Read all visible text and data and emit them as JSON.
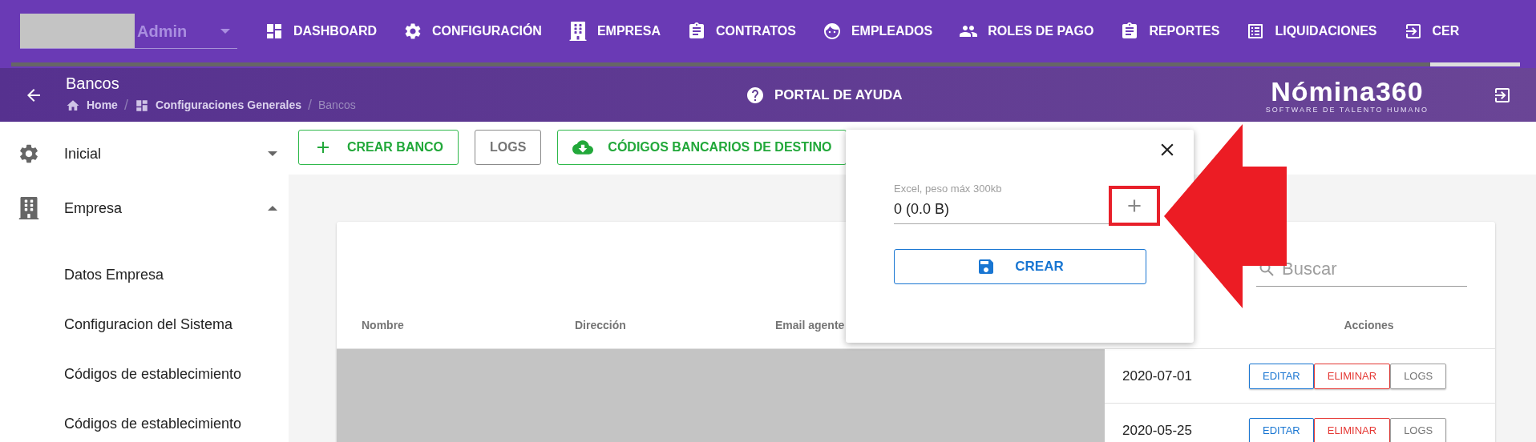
{
  "top_nav": {
    "user_select": {
      "value": "Admin"
    },
    "items": [
      {
        "label": "DASHBOARD"
      },
      {
        "label": "CONFIGURACIÓN"
      },
      {
        "label": "EMPRESA"
      },
      {
        "label": "CONTRATOS"
      },
      {
        "label": "EMPLEADOS"
      },
      {
        "label": "ROLES DE PAGO"
      },
      {
        "label": "REPORTES"
      },
      {
        "label": "LIQUIDACIONES"
      },
      {
        "label": "CER"
      }
    ]
  },
  "header": {
    "title": "Bancos",
    "breadcrumb": [
      {
        "label": "Home"
      },
      {
        "separator": "/",
        "label": "Configuraciones Generales"
      },
      {
        "separator": "/",
        "label": "Bancos"
      }
    ],
    "help_link": "PORTAL DE AYUDA",
    "logo": {
      "name": "Nómina360",
      "tagline": "SOFTWARE DE TALENTO HUMANO"
    }
  },
  "sidebar": {
    "items": [
      {
        "label": "Inicial",
        "expanded": false
      },
      {
        "label": "Empresa",
        "expanded": true,
        "children": [
          {
            "label": "Datos Empresa"
          },
          {
            "label": "Configuracion del Sistema"
          },
          {
            "label": "Códigos de establecimiento"
          },
          {
            "label": "Códigos de establecimiento"
          }
        ]
      }
    ]
  },
  "toolbar": [
    {
      "label": "CREAR BANCO",
      "kind": "add"
    },
    {
      "label": "LOGS",
      "kind": "plain"
    },
    {
      "label": "CÓDIGOS BANCARIOS DE DESTINO",
      "kind": "download"
    }
  ],
  "table": {
    "search": {
      "placeholder": "Buscar"
    },
    "columns": [
      "Nombre",
      "Dirección",
      "Email agente",
      "Acciones"
    ],
    "rows": [
      {
        "date": "2020-07-01",
        "actions": [
          {
            "label": "EDITAR",
            "kind": "edit"
          },
          {
            "label": "ELIMINAR",
            "kind": "delete"
          },
          {
            "label": "LOGS",
            "kind": "logs"
          }
        ]
      },
      {
        "date": "2020-05-25",
        "actions": [
          {
            "label": "EDITAR",
            "kind": "edit"
          },
          {
            "label": "ELIMINAR",
            "kind": "delete"
          },
          {
            "label": "LOGS",
            "kind": "logs"
          }
        ]
      }
    ]
  },
  "upload_popup": {
    "field_label": "Excel, peso máx 300kb",
    "field_value": "0 (0.0 B)",
    "submit": "CREAR"
  }
}
